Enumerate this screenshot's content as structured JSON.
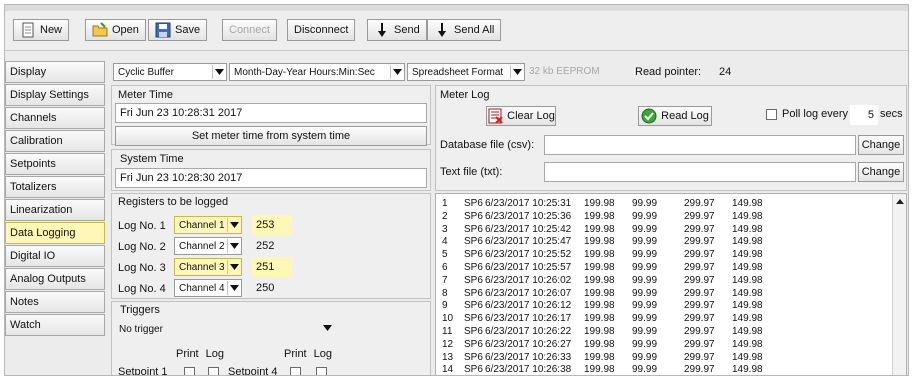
{
  "toolbar": {
    "new": "New",
    "open": "Open",
    "save": "Save",
    "connect": "Connect",
    "disconnect": "Disconnect",
    "send": "Send",
    "send_all": "Send All"
  },
  "sidebar": {
    "items": [
      {
        "label": "Display"
      },
      {
        "label": "Display Settings"
      },
      {
        "label": "Channels"
      },
      {
        "label": "Calibration"
      },
      {
        "label": "Setpoints"
      },
      {
        "label": "Totalizers"
      },
      {
        "label": "Linearization"
      },
      {
        "label": "Data Logging"
      },
      {
        "label": "Digital IO"
      },
      {
        "label": "Analog Outputs"
      },
      {
        "label": "Notes"
      },
      {
        "label": "Watch"
      }
    ]
  },
  "top": {
    "buffer": "Cyclic Buffer",
    "date_format": "Month-Day-Year Hours:Min:Sec",
    "file_format": "Spreadsheet Format",
    "eeprom": "32 kb EEPROM",
    "read_pointer_label": "Read pointer:",
    "read_pointer_value": "24"
  },
  "meter_time": {
    "title": "Meter Time",
    "value": "Fri Jun 23 10:28:31 2017",
    "set_button": "Set meter time from system time"
  },
  "system_time": {
    "title": "System Time",
    "value": "Fri Jun 23 10:28:30 2017"
  },
  "registers": {
    "title": "Registers to be logged",
    "rows": [
      {
        "label": "Log No. 1",
        "channel": "Channel 1",
        "value": "253"
      },
      {
        "label": "Log No. 2",
        "channel": "Channel 2",
        "value": "252"
      },
      {
        "label": "Log No. 3",
        "channel": "Channel 3",
        "value": "251"
      },
      {
        "label": "Log No. 4",
        "channel": "Channel 4",
        "value": "250"
      }
    ]
  },
  "triggers": {
    "title": "Triggers",
    "value": "No trigger",
    "col_headers": "Print  Log",
    "setpoint1": "Setpoint 1",
    "setpoint4": "Setpoint 4"
  },
  "meter_log": {
    "title": "Meter Log",
    "clear_button": "Clear Log",
    "read_button": "Read Log",
    "poll_label": "Poll log every",
    "poll_value": "5",
    "poll_unit": "secs",
    "db_label": "Database file (csv):",
    "text_label": "Text file (txt):",
    "change": "Change"
  },
  "log_entries": [
    {
      "n": "1",
      "tag": "SP6",
      "datetime": "6/23/2017 10:25:31",
      "v1": "199.98",
      "v2": "99.99",
      "v3": "299.97",
      "v4": "149.98"
    },
    {
      "n": "2",
      "tag": "SP6",
      "datetime": "6/23/2017 10:25:36",
      "v1": "199.98",
      "v2": "99.99",
      "v3": "299.97",
      "v4": "149.98"
    },
    {
      "n": "3",
      "tag": "SP6",
      "datetime": "6/23/2017 10:25:42",
      "v1": "199.98",
      "v2": "99.99",
      "v3": "299.97",
      "v4": "149.98"
    },
    {
      "n": "4",
      "tag": "SP6",
      "datetime": "6/23/2017 10:25:47",
      "v1": "199.98",
      "v2": "99.99",
      "v3": "299.97",
      "v4": "149.98"
    },
    {
      "n": "5",
      "tag": "SP6",
      "datetime": "6/23/2017 10:25:52",
      "v1": "199.98",
      "v2": "99.99",
      "v3": "299.97",
      "v4": "149.98"
    },
    {
      "n": "6",
      "tag": "SP6",
      "datetime": "6/23/2017 10:25:57",
      "v1": "199.98",
      "v2": "99.99",
      "v3": "299.97",
      "v4": "149.98"
    },
    {
      "n": "7",
      "tag": "SP6",
      "datetime": "6/23/2017 10:26:02",
      "v1": "199.98",
      "v2": "99.99",
      "v3": "299.97",
      "v4": "149.98"
    },
    {
      "n": "8",
      "tag": "SP6",
      "datetime": "6/23/2017 10:26:07",
      "v1": "199.98",
      "v2": "99.99",
      "v3": "299.97",
      "v4": "149.98"
    },
    {
      "n": "9",
      "tag": "SP6",
      "datetime": "6/23/2017 10:26:12",
      "v1": "199.98",
      "v2": "99.99",
      "v3": "299.97",
      "v4": "149.98"
    },
    {
      "n": "10",
      "tag": "SP6",
      "datetime": "6/23/2017 10:26:17",
      "v1": "199.98",
      "v2": "99.99",
      "v3": "299.97",
      "v4": "149.98"
    },
    {
      "n": "11",
      "tag": "SP6",
      "datetime": "6/23/2017 10:26:22",
      "v1": "199.98",
      "v2": "99.99",
      "v3": "299.97",
      "v4": "149.98"
    },
    {
      "n": "12",
      "tag": "SP6",
      "datetime": "6/23/2017 10:26:27",
      "v1": "199.98",
      "v2": "99.99",
      "v3": "299.97",
      "v4": "149.98"
    },
    {
      "n": "13",
      "tag": "SP6",
      "datetime": "6/23/2017 10:26:33",
      "v1": "199.98",
      "v2": "99.99",
      "v3": "299.97",
      "v4": "149.98"
    },
    {
      "n": "14",
      "tag": "SP6",
      "datetime": "6/23/2017 10:26:38",
      "v1": "199.98",
      "v2": "99.99",
      "v3": "299.97",
      "v4": "149.98"
    }
  ]
}
